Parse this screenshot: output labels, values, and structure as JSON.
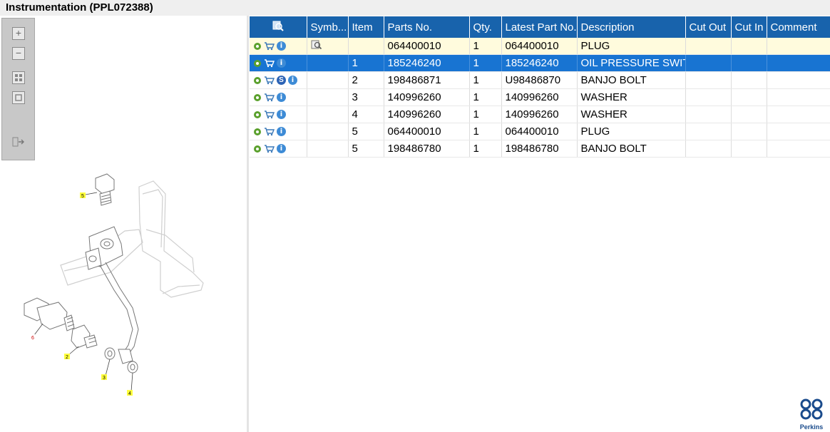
{
  "window": {
    "title": "Instrumentation (PPL072388)"
  },
  "toolbox": {
    "buttons": [
      "zoom-in",
      "zoom-out",
      "fit-all",
      "fit-page",
      "export"
    ]
  },
  "drawing": {
    "callouts": [
      "5",
      "6",
      "2",
      "3",
      "4"
    ]
  },
  "grid": {
    "columns": [
      "",
      "Symb...",
      "Item",
      "Parts No.",
      "Qty.",
      "Latest Part No.",
      "Description",
      "Cut Out",
      "Cut In",
      "Comment"
    ],
    "rows": [
      {
        "item": "",
        "parts_no": "064400010",
        "qty": "1",
        "latest": "064400010",
        "description": "PLUG",
        "cut_out": "",
        "cut_in": "",
        "comment": "",
        "state": "highlighted",
        "has_symbol": true,
        "has_s": false
      },
      {
        "item": "1",
        "parts_no": "185246240",
        "qty": "1",
        "latest": "185246240",
        "description": "OIL PRESSURE SWITCH",
        "cut_out": "",
        "cut_in": "",
        "comment": "",
        "state": "selected",
        "has_symbol": false,
        "has_s": false
      },
      {
        "item": "2",
        "parts_no": "198486871",
        "qty": "1",
        "latest": "U98486870",
        "description": "BANJO BOLT",
        "cut_out": "",
        "cut_in": "",
        "comment": "",
        "state": "normal",
        "has_symbol": false,
        "has_s": true
      },
      {
        "item": "3",
        "parts_no": "140996260",
        "qty": "1",
        "latest": "140996260",
        "description": "WASHER",
        "cut_out": "",
        "cut_in": "",
        "comment": "",
        "state": "normal",
        "has_symbol": false,
        "has_s": false
      },
      {
        "item": "4",
        "parts_no": "140996260",
        "qty": "1",
        "latest": "140996260",
        "description": "WASHER",
        "cut_out": "",
        "cut_in": "",
        "comment": "",
        "state": "normal",
        "has_symbol": false,
        "has_s": false
      },
      {
        "item": "5",
        "parts_no": "064400010",
        "qty": "1",
        "latest": "064400010",
        "description": "PLUG",
        "cut_out": "",
        "cut_in": "",
        "comment": "",
        "state": "normal",
        "has_symbol": false,
        "has_s": false
      },
      {
        "item": "5",
        "parts_no": "198486780",
        "qty": "1",
        "latest": "198486780",
        "description": "BANJO BOLT",
        "cut_out": "",
        "cut_in": "",
        "comment": "",
        "state": "normal",
        "has_symbol": false,
        "has_s": false
      }
    ],
    "s_badge": "S",
    "info_badge": "i"
  },
  "logo": {
    "text": "Perkins"
  },
  "colors": {
    "header": "#1863ac",
    "selected": "#1874d2",
    "highlight": "#fffbdd",
    "gear": "#5aa02c",
    "cart": "#3a78b8"
  }
}
